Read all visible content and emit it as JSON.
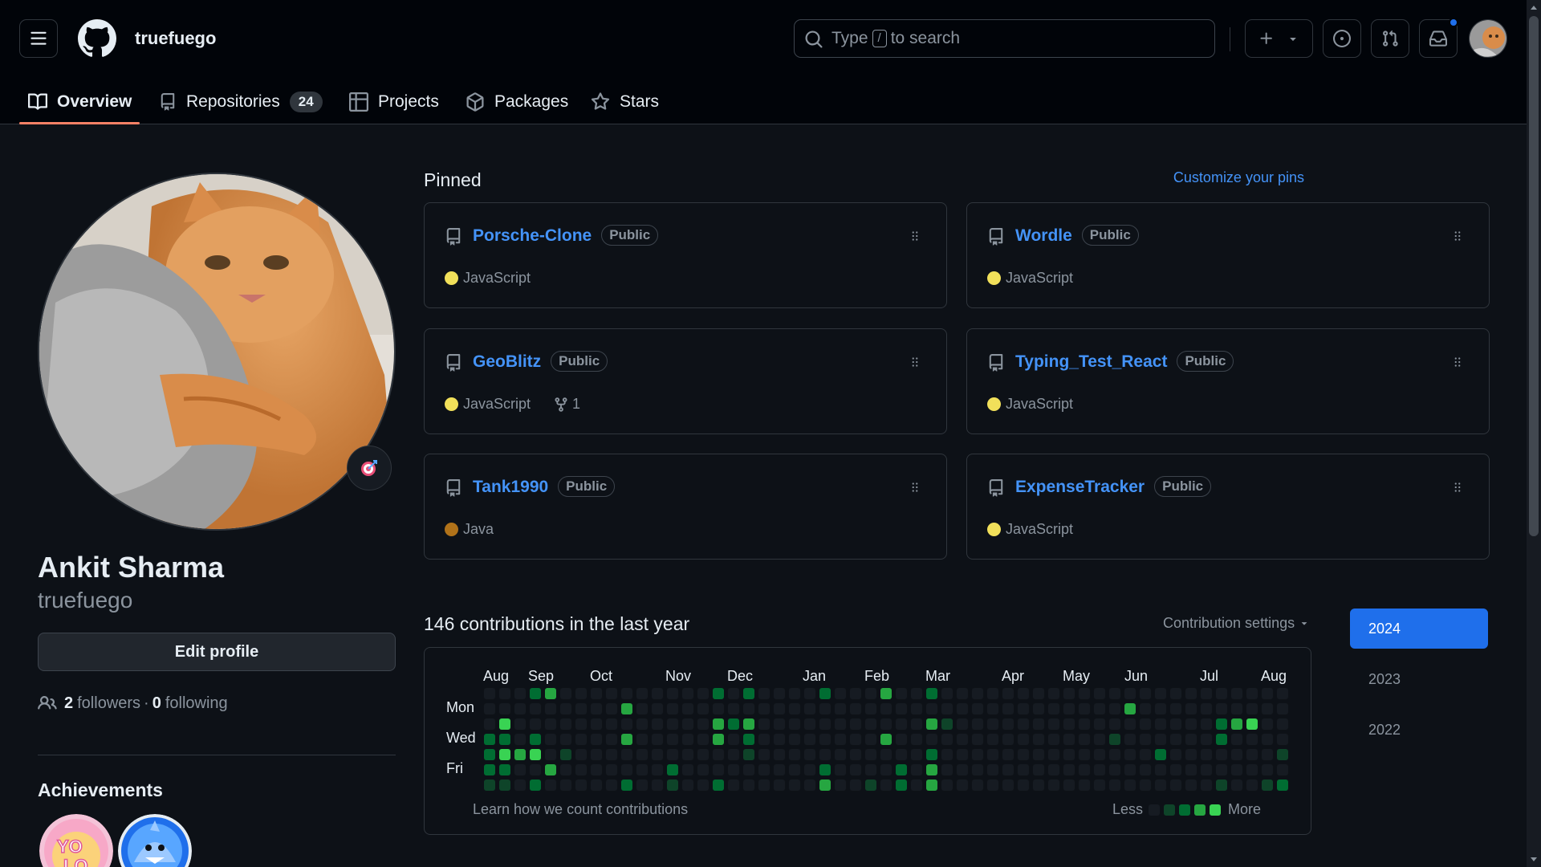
{
  "header": {
    "username": "truefuego",
    "search_pre": "Type",
    "search_key": "/",
    "search_post": "to search"
  },
  "nav": {
    "overview": "Overview",
    "repositories": "Repositories",
    "repo_count": "24",
    "projects": "Projects",
    "packages": "Packages",
    "stars": "Stars"
  },
  "profile": {
    "name": "Ankit Sharma",
    "login": "truefuego",
    "edit": "Edit profile",
    "followers_count": "2",
    "followers_label": "followers",
    "dot": "·",
    "following_count": "0",
    "following_label": "following",
    "achievements_title": "Achievements",
    "achievement_badges": [
      "yolo",
      "shark"
    ]
  },
  "pinned": {
    "title": "Pinned",
    "customize": "Customize your pins",
    "repos": [
      {
        "name": "Porsche-Clone",
        "visibility": "Public",
        "language": "JavaScript",
        "color": "#f1e05a",
        "forks": ""
      },
      {
        "name": "Wordle",
        "visibility": "Public",
        "language": "JavaScript",
        "color": "#f1e05a",
        "forks": ""
      },
      {
        "name": "GeoBlitz",
        "visibility": "Public",
        "language": "JavaScript",
        "color": "#f1e05a",
        "forks": "1"
      },
      {
        "name": "Typing_Test_React",
        "visibility": "Public",
        "language": "JavaScript",
        "color": "#f1e05a",
        "forks": ""
      },
      {
        "name": "Tank1990",
        "visibility": "Public",
        "language": "Java",
        "color": "#b07219",
        "forks": ""
      },
      {
        "name": "ExpenseTracker",
        "visibility": "Public",
        "language": "JavaScript",
        "color": "#f1e05a",
        "forks": ""
      }
    ]
  },
  "contributions": {
    "title": "146 contributions in the last year",
    "settings": "Contribution settings",
    "months": [
      "Aug",
      "Sep",
      "Oct",
      "Nov",
      "Dec",
      "Jan",
      "Feb",
      "Mar",
      "Apr",
      "May",
      "Jun",
      "Jul",
      "Aug"
    ],
    "days": [
      "Mon",
      "Wed",
      "Fri"
    ],
    "learn": "Learn how we count contributions",
    "less": "Less",
    "more": "More",
    "level_colors": [
      "#161b22",
      "#0e4429",
      "#006d32",
      "#26a641",
      "#39d353"
    ],
    "active": [
      [
        0,
        3,
        2
      ],
      [
        0,
        4,
        2
      ],
      [
        0,
        5,
        2
      ],
      [
        0,
        6,
        1
      ],
      [
        1,
        2,
        4
      ],
      [
        1,
        3,
        2
      ],
      [
        1,
        4,
        4
      ],
      [
        1,
        5,
        2
      ],
      [
        1,
        6,
        1
      ],
      [
        2,
        4,
        3
      ],
      [
        3,
        0,
        2
      ],
      [
        3,
        3,
        2
      ],
      [
        3,
        4,
        4
      ],
      [
        3,
        6,
        2
      ],
      [
        4,
        0,
        3
      ],
      [
        4,
        5,
        3
      ],
      [
        5,
        4,
        1
      ],
      [
        9,
        1,
        3
      ],
      [
        9,
        3,
        3
      ],
      [
        9,
        6,
        2
      ],
      [
        12,
        5,
        2
      ],
      [
        12,
        6,
        1
      ],
      [
        15,
        0,
        2
      ],
      [
        15,
        2,
        3
      ],
      [
        15,
        3,
        3
      ],
      [
        15,
        6,
        2
      ],
      [
        16,
        2,
        2
      ],
      [
        17,
        0,
        2
      ],
      [
        17,
        2,
        3
      ],
      [
        17,
        3,
        2
      ],
      [
        17,
        4,
        1
      ],
      [
        22,
        0,
        2
      ],
      [
        22,
        5,
        2
      ],
      [
        22,
        6,
        3
      ],
      [
        25,
        6,
        1
      ],
      [
        26,
        0,
        3
      ],
      [
        26,
        3,
        3
      ],
      [
        27,
        5,
        2
      ],
      [
        27,
        6,
        2
      ],
      [
        29,
        0,
        2
      ],
      [
        29,
        2,
        3
      ],
      [
        29,
        4,
        2
      ],
      [
        29,
        5,
        3
      ],
      [
        29,
        6,
        3
      ],
      [
        30,
        2,
        1
      ],
      [
        41,
        3,
        1
      ],
      [
        42,
        1,
        3
      ],
      [
        44,
        4,
        2
      ],
      [
        48,
        2,
        2
      ],
      [
        48,
        3,
        2
      ],
      [
        48,
        6,
        1
      ],
      [
        49,
        2,
        3
      ],
      [
        50,
        2,
        4
      ],
      [
        51,
        6,
        1
      ],
      [
        52,
        4,
        1
      ],
      [
        52,
        6,
        2
      ]
    ]
  },
  "years": [
    "2024",
    "2023",
    "2022"
  ]
}
